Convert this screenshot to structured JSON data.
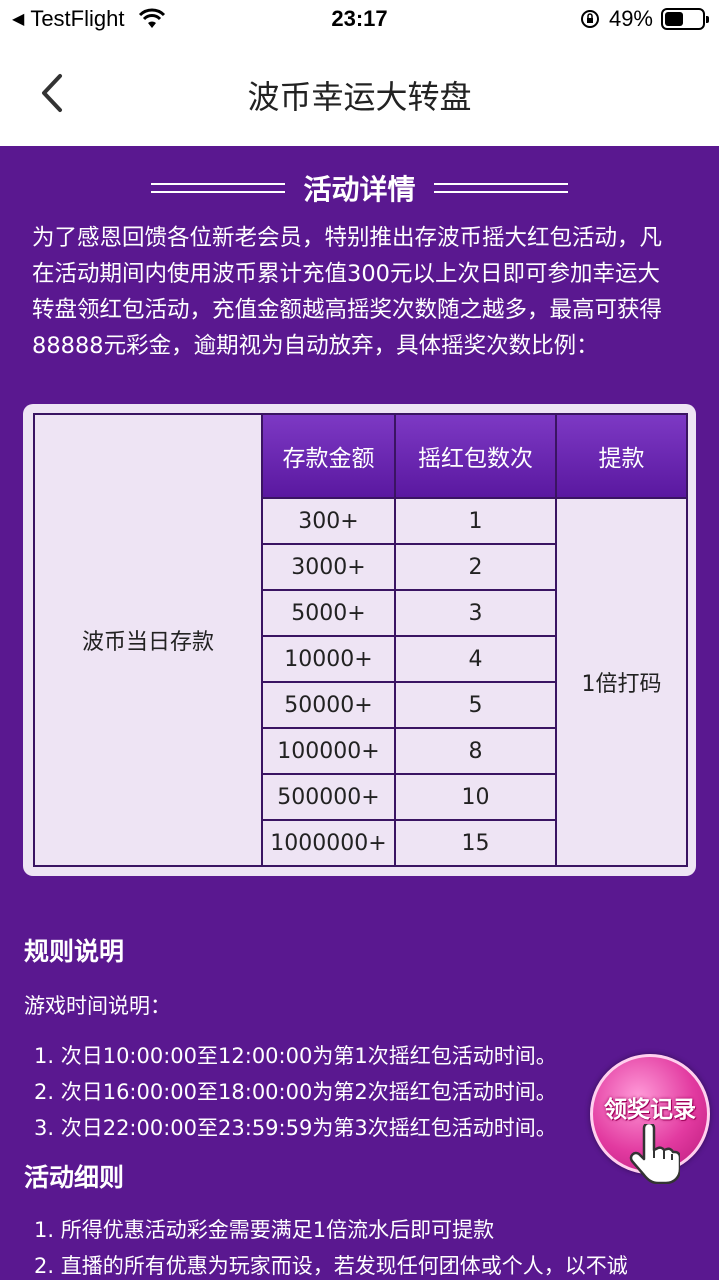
{
  "status_bar": {
    "back_app": "TestFlight",
    "time": "23:17",
    "battery_percent": "49%",
    "battery_level": 0.49
  },
  "nav": {
    "title": "波币幸运大转盘"
  },
  "activity": {
    "heading": "活动详情",
    "intro_lines": [
      "为了感恩回馈各位新老会员，特别推出存波币摇大红包活动，凡",
      "在活动期间内使用波币累计充值300元以上次日即可参加幸运大",
      "转盘领红包活动，充值金额越高摇奖次数随之越多，最高可获得",
      "88888元彩金，逾期视为自动放弃，具体摇奖次数比例："
    ]
  },
  "table": {
    "headers": [
      "存款金额",
      "摇红包数次",
      "提款"
    ],
    "row_label": "波币当日存款",
    "withdraw_value": "1倍打码",
    "rows": [
      {
        "deposit": "300+",
        "spins": "1"
      },
      {
        "deposit": "3000+",
        "spins": "2"
      },
      {
        "deposit": "5000+",
        "spins": "3"
      },
      {
        "deposit": "10000+",
        "spins": "4"
      },
      {
        "deposit": "50000+",
        "spins": "5"
      },
      {
        "deposit": "100000+",
        "spins": "8"
      },
      {
        "deposit": "500000+",
        "spins": "10"
      },
      {
        "deposit": "1000000+",
        "spins": "15"
      }
    ]
  },
  "rules": {
    "heading": "规则说明",
    "subheading": "游戏时间说明：",
    "items": [
      "1. 次日10:00:00至12:00:00为第1次摇红包活动时间。",
      "2. 次日16:00:00至18:00:00为第2次摇红包活动时间。",
      "3. 次日22:00:00至23:59:59为第3次摇红包活动时间。"
    ]
  },
  "details": {
    "heading": "活动细则",
    "items": [
      "1. 所得优惠活动彩金需要满足1倍流水后即可提款",
      "2. 直播的所有优惠为玩家而设，若发现任何团体或个人，以不诚"
    ]
  },
  "fab": {
    "label": "领奖记录"
  }
}
